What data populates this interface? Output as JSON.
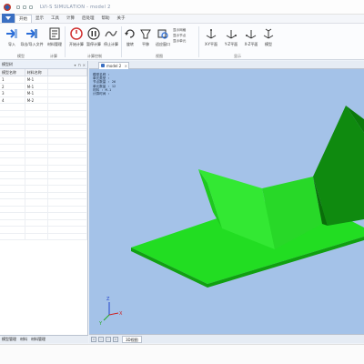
{
  "window": {
    "title": "LVI-S SIMULATION - model 2"
  },
  "menu": {
    "items": [
      "开始",
      "显示",
      "工具",
      "计算",
      "后处理",
      "帮助",
      "关于"
    ],
    "active_index": 0
  },
  "ribbon": {
    "buttons": [
      {
        "label": "导入",
        "icon": "import-arrow-icon"
      },
      {
        "label": "导出/导入文件",
        "icon": "export-arrow-icon"
      },
      {
        "label": "材料管理",
        "icon": "material-icon"
      },
      {
        "label": "开始计算",
        "icon": "start-calc-icon"
      },
      {
        "label": "暂停计算",
        "icon": "pause-icon"
      },
      {
        "label": "停止计算",
        "icon": "stop-wave-icon"
      },
      {
        "label": "旋转",
        "icon": "rotate-icon"
      },
      {
        "label": "平移",
        "icon": "pan-icon"
      },
      {
        "label": "适应窗口",
        "icon": "fit-icon"
      },
      {
        "label": "X-Y平面",
        "icon": "xy-plane-icon"
      },
      {
        "label": "Y-Z平面",
        "icon": "yz-plane-icon"
      },
      {
        "label": "X-Z平面",
        "icon": "xz-plane-icon"
      },
      {
        "label": "模型",
        "icon": "model-icon"
      }
    ],
    "small_list": [
      "显示网格",
      "显示节点",
      "显示单元"
    ],
    "groups": [
      "模型",
      "计算",
      "计算控制",
      "视图",
      "显示"
    ]
  },
  "left_panel": {
    "title": "模型树",
    "controls": [
      "▾",
      "⊓",
      "×"
    ],
    "columns": [
      "模型名称",
      "材料名称",
      ""
    ],
    "rows": [
      {
        "id": "1",
        "material": "M-1"
      },
      {
        "id": "2",
        "material": "M-1"
      },
      {
        "id": "3",
        "material": "M-1"
      },
      {
        "id": "4",
        "material": "M-2"
      }
    ],
    "bottom_tabs": [
      "模型管理",
      "材料",
      "材料管理"
    ]
  },
  "document_tab": {
    "label": "model 2"
  },
  "viewport": {
    "info_lines": [
      "模型名称 :",
      "单元类型 :",
      "节点数量 : 26",
      "单元数量 : 12",
      "材料 : M-1",
      "计算时间 :"
    ],
    "axis": {
      "x": "X",
      "y": "Y",
      "z": "Z"
    },
    "bottom_tab": "3D视图"
  },
  "colors": {
    "plate_face": "#22dd22",
    "plate_side": "#12a012",
    "plate_dark": "#0f8a0f",
    "background": "#a4c2e8",
    "accent": "#3a6fc2"
  }
}
